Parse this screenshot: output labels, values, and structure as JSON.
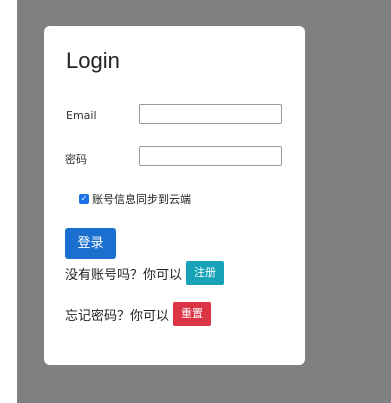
{
  "login_card": {
    "title": "Login",
    "email_label": "Email",
    "email_value": "",
    "password_label": "密码",
    "password_value": "",
    "sync_checkbox": {
      "label": "账号信息同步到云端",
      "checked": true
    },
    "login_button": "登录",
    "register_prompt": "没有账号吗？你可以",
    "register_button": "注册",
    "forgot_prompt": "忘记密码？你可以",
    "reset_button": "重置"
  },
  "colors": {
    "backdrop": "#808080",
    "primary": "#1a6fcf",
    "info": "#17a2b8",
    "danger": "#dc3545"
  },
  "icons": {
    "checkbox": "check-icon"
  }
}
